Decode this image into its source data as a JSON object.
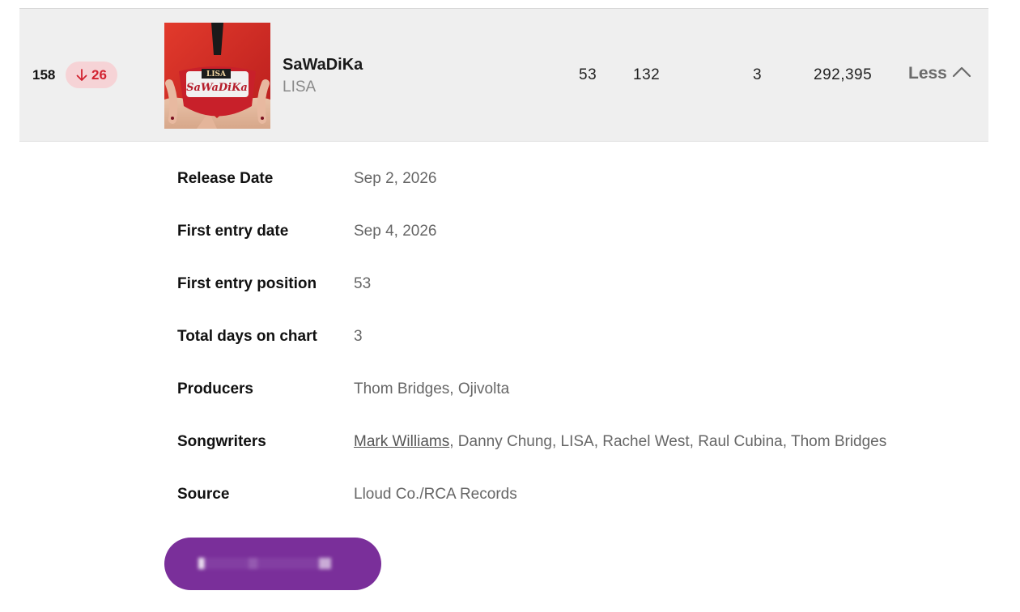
{
  "entry": {
    "rank": "158",
    "movement": {
      "direction": "down",
      "value": "26",
      "color": "#d22230",
      "background": "#f6d3d6",
      "icon": "arrow-down-icon"
    },
    "title": "SaWaDiKa",
    "artist": "LISA",
    "stats": [
      "53",
      "132",
      "3",
      "292,395"
    ],
    "toggle_label": "Less",
    "toggle_icon": "chevron-up-icon",
    "cover_art_icon": "album-cover-image"
  },
  "details": [
    {
      "label": "Release Date",
      "value": "Sep 2, 2026"
    },
    {
      "label": "First entry date",
      "value": "Sep 4, 2026"
    },
    {
      "label": "First entry position",
      "value": "53"
    },
    {
      "label": "Total days on chart",
      "value": "3"
    },
    {
      "label": "Producers",
      "value": "Thom Bridges, Ojivolta"
    },
    {
      "label": "Songwriters",
      "value_link": "Mark Williams",
      "value": ", Danny Chung, LISA, Rachel West, Raul Cubina, Thom Bridges"
    },
    {
      "label": "Source",
      "value": "Lloud Co./RCA Records"
    }
  ],
  "cta": {
    "color": "#7a2f9a"
  },
  "colors": {
    "row_background": "#efefef",
    "label": "#111111",
    "value": "#666666"
  }
}
